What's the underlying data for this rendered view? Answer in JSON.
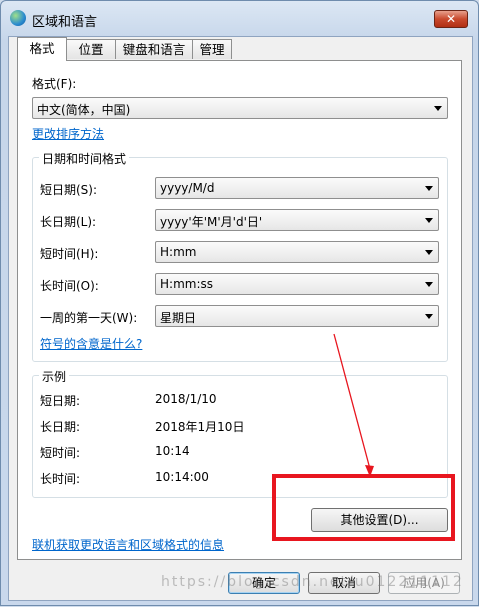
{
  "window": {
    "title": "区域和语言",
    "close_label": "✕"
  },
  "tabs": [
    {
      "label": "格式"
    },
    {
      "label": "位置"
    },
    {
      "label": "键盘和语言"
    },
    {
      "label": "管理"
    }
  ],
  "format": {
    "label": "格式(F):",
    "selected": "中文(简体，中国)",
    "change_sort_link": "更改排序方法"
  },
  "datetime": {
    "group_title": "日期和时间格式",
    "fields": [
      {
        "label": "短日期(S):",
        "value": "yyyy/M/d"
      },
      {
        "label": "长日期(L):",
        "value": "yyyy'年'M'月'd'日'"
      },
      {
        "label": "短时间(H):",
        "value": "H:mm"
      },
      {
        "label": "长时间(O):",
        "value": "H:mm:ss"
      },
      {
        "label": "一周的第一天(W):",
        "value": "星期日"
      }
    ],
    "symbols_link": "符号的含意是什么?"
  },
  "examples": {
    "group_title": "示例",
    "rows": [
      {
        "label": "短日期:",
        "value": "2018/1/10"
      },
      {
        "label": "长日期:",
        "value": "2018年1月10日"
      },
      {
        "label": "短时间:",
        "value": "10:14"
      },
      {
        "label": "长时间:",
        "value": "10:14:00"
      }
    ]
  },
  "additional_settings_button": "其他设置(D)...",
  "online_link": "联机获取更改语言和区域格式的信息",
  "footer": {
    "ok": "确定",
    "cancel": "取消",
    "apply": "应用(A)"
  },
  "watermark": "https://blog.csdn.net/u012211112",
  "annotation_color": "#e8161f"
}
